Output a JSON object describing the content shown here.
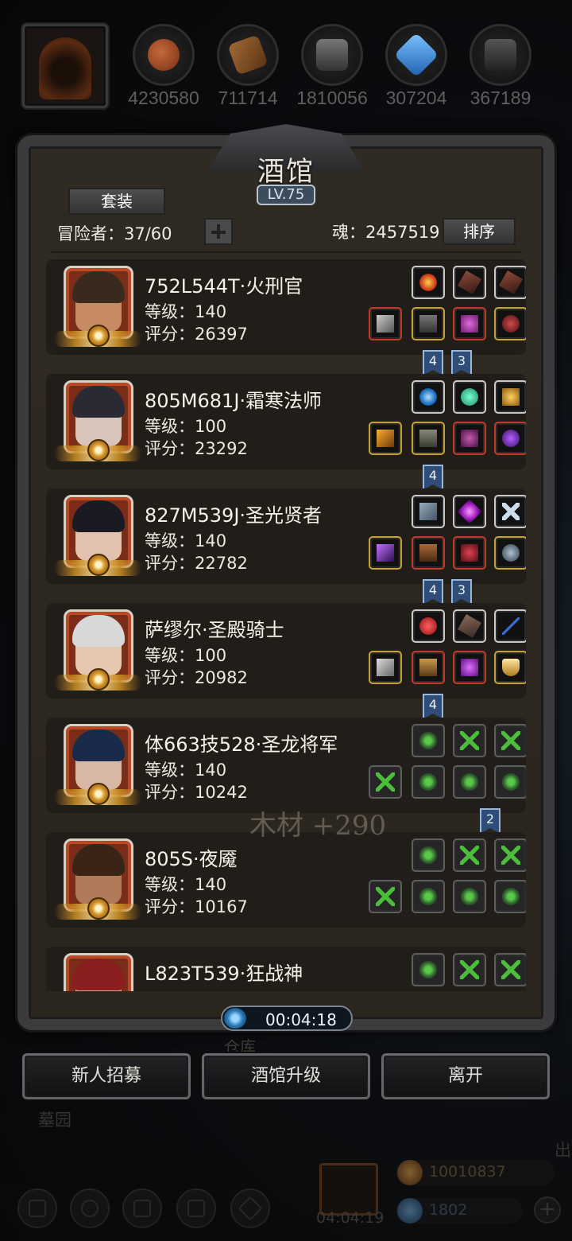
{
  "resources": [
    {
      "icon": "meat-icon",
      "value": "4230580",
      "color": "#8b3d1c"
    },
    {
      "icon": "wood-icon",
      "value": "711714",
      "color": "#7a4a22"
    },
    {
      "icon": "iron-icon",
      "value": "1810056",
      "color": "#555555"
    },
    {
      "icon": "crystal-icon",
      "value": "307204",
      "color": "#2f7fd6"
    },
    {
      "icon": "stone-icon",
      "value": "367189",
      "color": "#4a4a4a"
    }
  ],
  "panel": {
    "title": "酒馆",
    "level": "LV.75",
    "suit_label": "套装",
    "adventurers_label": "冒险者：37/60",
    "soul_label": "魂：2457519",
    "sort_label": "排序"
  },
  "heroes": [
    {
      "name": "752L544T·火刑官",
      "level": "等级：140",
      "score": "评分：26397"
    },
    {
      "name": "805M681J·霜寒法师",
      "level": "等级：100",
      "score": "评分：23292"
    },
    {
      "name": "827M539J·圣光贤者",
      "level": "等级：140",
      "score": "评分：22782"
    },
    {
      "name": "萨缪尔·圣殿骑士",
      "level": "等级：100",
      "score": "评分：20982"
    },
    {
      "name": "体663技528·圣龙将军",
      "level": "等级：140",
      "score": "评分：10242"
    },
    {
      "name": "805S·夜魇",
      "level": "等级：140",
      "score": "评分：10167"
    },
    {
      "name": "L823T539·狂战神",
      "level": "",
      "score": ""
    }
  ],
  "badges": [
    "4",
    "3",
    "4",
    "4",
    "3",
    "4",
    "2"
  ],
  "floating_text": "木材 +290",
  "timer": "00:04:18",
  "buttons": {
    "recruit": "新人招募",
    "upgrade": "酒馆升级",
    "leave": "离开"
  },
  "footer": {
    "warehouse": "仓库",
    "cemetery": "墓园",
    "exit": "出",
    "gift_timer": "04:04:19",
    "gold": "10010837",
    "gems": "1802"
  }
}
